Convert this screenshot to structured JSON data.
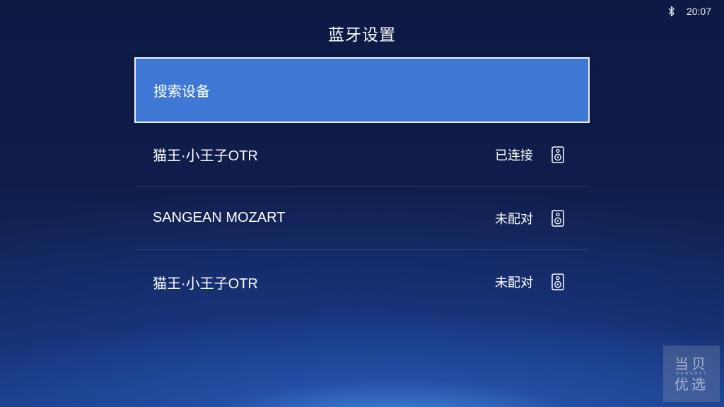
{
  "status_bar": {
    "bluetooth_icon": "bluetooth-icon",
    "time": "20:07"
  },
  "page": {
    "title": "蓝牙设置"
  },
  "search": {
    "label": "搜索设备"
  },
  "devices": [
    {
      "name": "猫王·小王子OTR",
      "status": "已连接",
      "icon": "speaker-icon"
    },
    {
      "name": "SANGEAN MOZART",
      "status": "未配对",
      "icon": "speaker-icon"
    },
    {
      "name": "猫王·小王子OTR",
      "status": "未配对",
      "icon": "speaker-icon"
    }
  ],
  "watermark": {
    "line1": "当贝",
    "line2": "DANGBEI",
    "line3": "优选"
  },
  "colors": {
    "selected_item": "#3f78d4",
    "background_top": "#0e1a44",
    "background_glow": "#3f8fe0"
  }
}
